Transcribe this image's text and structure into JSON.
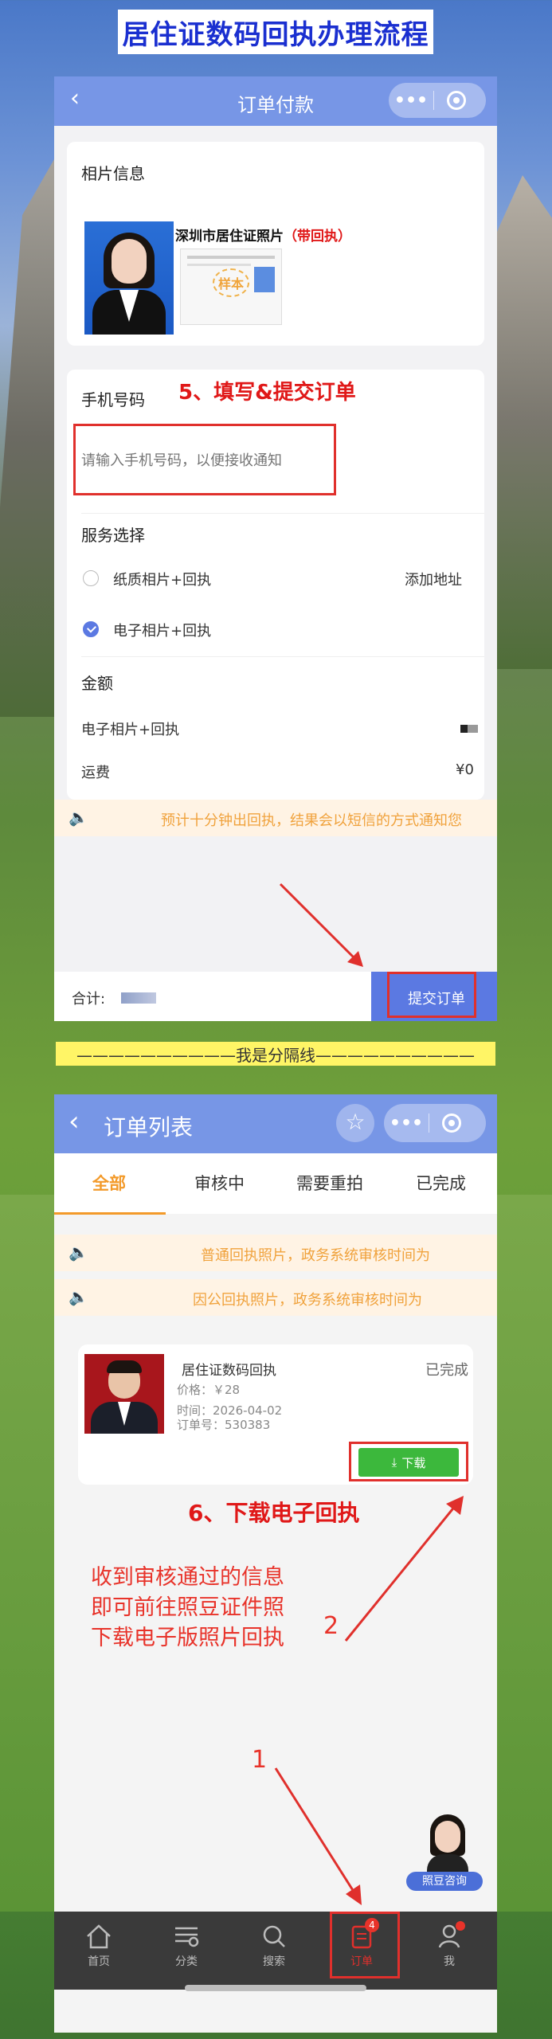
{
  "banner": {
    "title": "居住证数码回执办理流程"
  },
  "screen1": {
    "nav_title": "订单付款",
    "photo_section": {
      "label": "相片信息",
      "product_name": "深圳市居住证照片",
      "product_tag": "（带回执）"
    },
    "step5": "5、填写&提交订单",
    "phone": {
      "label": "手机号码",
      "placeholder": "请输入手机号码，以便接收通知"
    },
    "service": {
      "label": "服务选择",
      "options": [
        {
          "label": "纸质相片+回执",
          "extra": "添加地址",
          "selected": false
        },
        {
          "label": "电子相片+回执",
          "extra": "",
          "selected": true
        }
      ]
    },
    "amount": {
      "label": "金额",
      "item_label": "电子相片+回执",
      "shipping_label": "运费",
      "shipping_value": "¥0"
    },
    "notice": "预计十分钟出回执，结果会以短信的方式通知您",
    "footer": {
      "total_label": "合计:",
      "submit_label": "提交订单"
    }
  },
  "divider": {
    "text": "——————————我是分隔线——————————"
  },
  "screen2": {
    "nav_title": "订单列表",
    "tabs": [
      "全部",
      "审核中",
      "需要重拍",
      "已完成"
    ],
    "notices": [
      "普通回执照片，政务系统审核时间为",
      "因公回执照片，政务系统审核时间为"
    ],
    "order": {
      "title": "居住证数码回执",
      "status": "已完成",
      "price": "价格：￥28",
      "time": "时间：2026-04-02",
      "order_no": "订单号：530383",
      "download": "下载"
    },
    "step6": "6、下载电子回执",
    "note_lines": [
      "收到审核通过的信息",
      "即可前往照豆证件照",
      "下载电子版照片回执"
    ],
    "arrow_label_1": "1",
    "arrow_label_2": "2",
    "consult_label": "照豆咨询",
    "tabbar": [
      {
        "label": "首页",
        "icon": "home-icon"
      },
      {
        "label": "分类",
        "icon": "category-icon"
      },
      {
        "label": "搜索",
        "icon": "search-icon"
      },
      {
        "label": "订单",
        "icon": "order-icon",
        "badge": "4"
      },
      {
        "label": "我",
        "icon": "user-icon"
      }
    ]
  },
  "colors": {
    "nav_blue": "#7796e6",
    "accent_orange": "#f39a2a",
    "highlight_red": "#e0302c",
    "download_green": "#3cb83c"
  }
}
